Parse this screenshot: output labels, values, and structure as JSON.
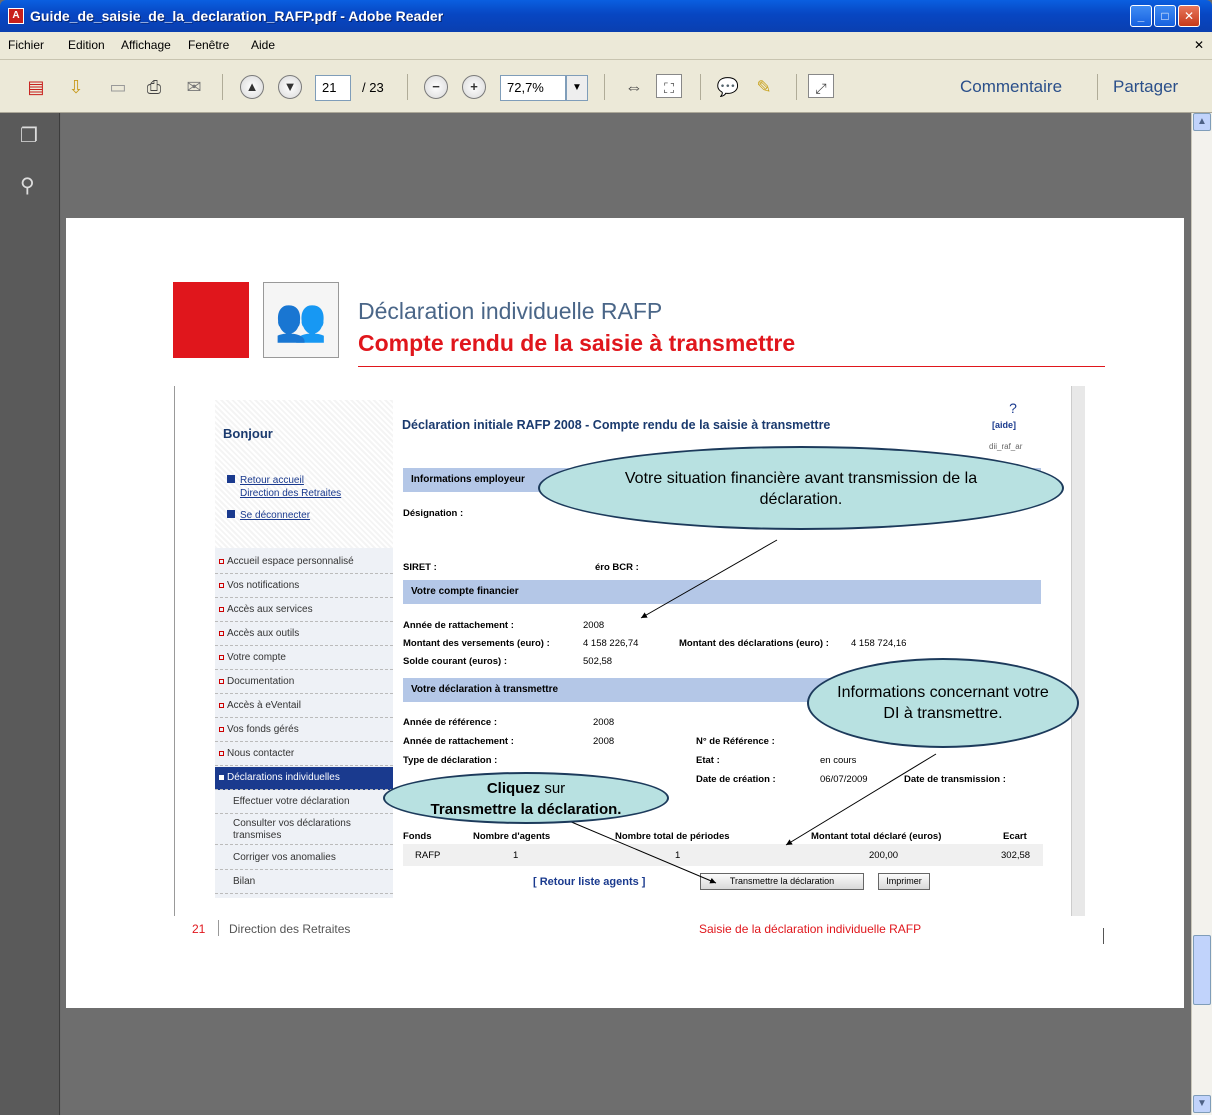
{
  "window": {
    "title": "Guide_de_saisie_de_la_declaration_RAFP.pdf - Adobe Reader",
    "menu": [
      "Fichier",
      "Edition",
      "Affichage",
      "Fenêtre",
      "Aide"
    ]
  },
  "toolbar": {
    "page_current": "21",
    "page_total": "/ 23",
    "zoom": "72,7%",
    "comment": "Commentaire",
    "share": "Partager"
  },
  "header": {
    "title1": "Déclaration individuelle RAFP",
    "title2": "Compte rendu de la saisie à transmettre"
  },
  "web": {
    "bonjour": "Bonjour",
    "links": {
      "retour": "Retour accueil",
      "direction": "Direction des Retraites",
      "deconnecter": "Se déconnecter"
    },
    "nav": [
      "Accueil espace personnalisé",
      "Vos notifications",
      "Accès aux services",
      "Accès aux outils",
      "Votre compte",
      "Documentation",
      "Accès à eVentail",
      "Vos fonds gérés",
      "Nous contacter",
      "Déclarations individuelles"
    ],
    "subnav": [
      "Effectuer votre déclaration",
      "Consulter vos déclarations transmises",
      "Corriger vos anomalies",
      "Bilan"
    ],
    "heading": "Déclaration initiale RAFP 2008 - Compte rendu de la saisie à transmettre",
    "aide": "[aide]",
    "code": "dii_raf_ar",
    "sec1": "Informations employeur",
    "designation": "Désignation :",
    "siret": "SIRET :",
    "bcr": "éro BCR :",
    "sec2": "Votre compte financier",
    "annee_ratt_label": "Année de rattachement :",
    "annee_ratt_val": "2008",
    "montant_vers_label": "Montant des versements (euro) :",
    "montant_vers_val": "4 158 226,74",
    "montant_decl_label": "Montant des déclarations (euro) :",
    "montant_decl_val": "4 158 724,16",
    "solde_label": "Solde courant (euros) :",
    "solde_val": "502,58",
    "sec3": "Votre déclaration à transmettre",
    "annee_ref_label": "Année de référence :",
    "annee_ref_val": "2008",
    "annee_ratt2_label": "Année de rattachement :",
    "annee_ratt2_val": "2008",
    "num_ref_label": "N° de Référence :",
    "type_label": "Type de déclaration :",
    "etat_label": "Etat :",
    "etat_val": "en cours",
    "date_creation_label": "Date de création :",
    "date_creation_val": "06/07/2009",
    "date_trans_label": "Date de transmission :",
    "table_headers": [
      "Fonds",
      "Nombre d'agents",
      "Nombre total de périodes",
      "Montant total déclaré (euros)",
      "Ecart"
    ],
    "table_row": [
      "RAFP",
      "1",
      "1",
      "200,00",
      "302,58"
    ],
    "retour_liste": "[ Retour liste agents ]",
    "btn_transmettre": "Transmettre la déclaration",
    "btn_imprimer": "Imprimer"
  },
  "bubbles": {
    "b1": "Votre situation financière avant transmission de la déclaration.",
    "b2": "Informations concernant votre DI à transmettre.",
    "b3_bold1": "Cliquez",
    "b3_rest1": " sur",
    "b3_bold2": "Transmettre la déclaration."
  },
  "footer": {
    "page": "21",
    "org": "Direction des Retraites",
    "right": "Saisie de la déclaration individuelle RAFP"
  },
  "colors": {
    "accent_red": "#e0161c",
    "titlebar": "#0a5fe0",
    "bubble": "#b8e1e1"
  }
}
